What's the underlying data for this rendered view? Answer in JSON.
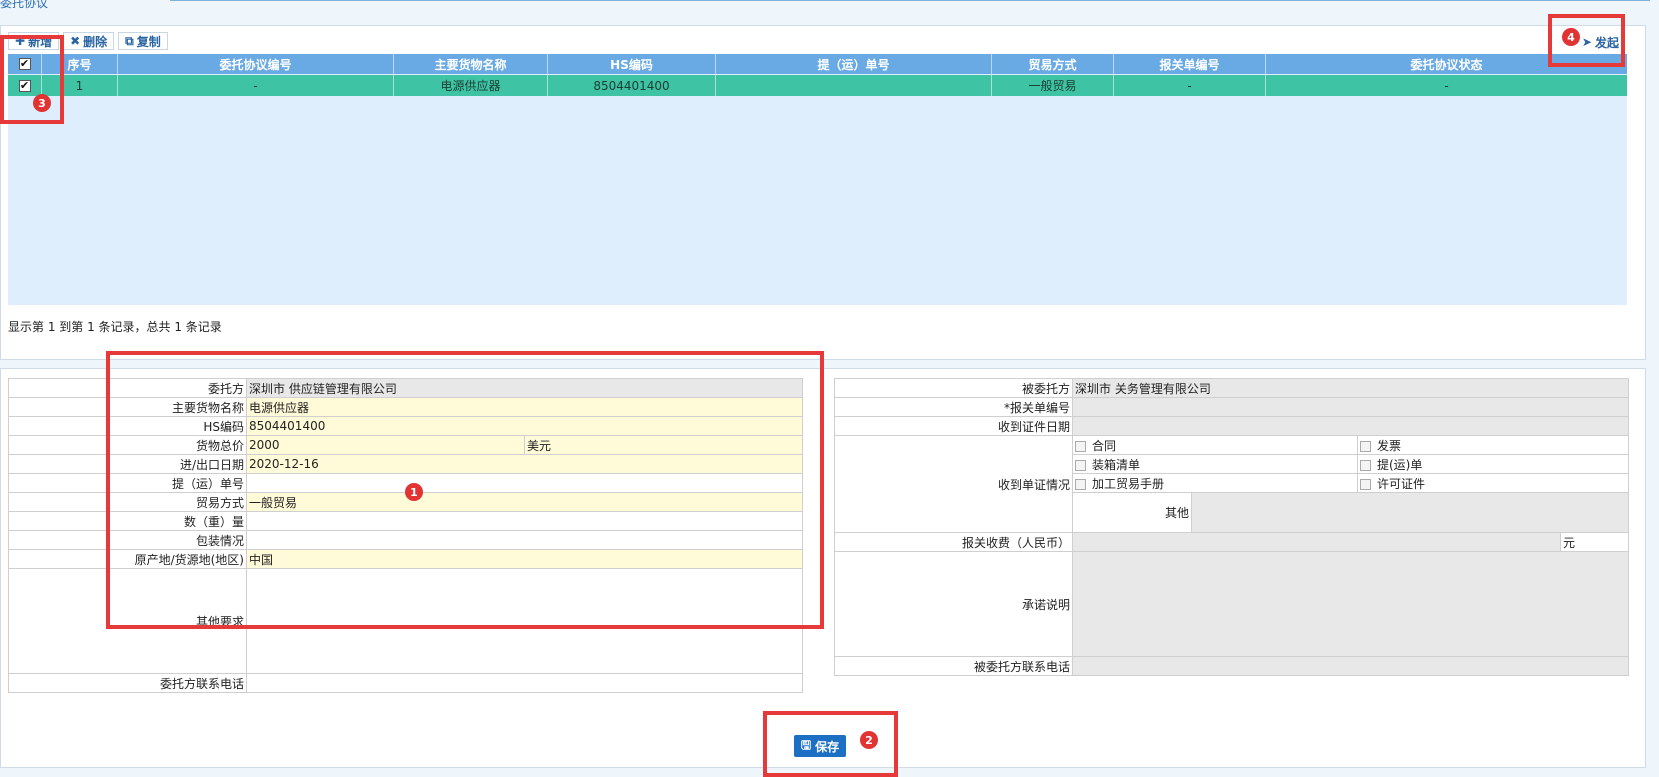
{
  "top_tab": "委托协议",
  "toolbar": {
    "add": "新增",
    "delete": "删除",
    "copy": "复制",
    "launch": "发起"
  },
  "grid": {
    "headers": [
      "序号",
      "委托协议编号",
      "主要货物名称",
      "HS编码",
      "提（运）单号",
      "贸易方式",
      "报关单编号",
      "委托协议状态"
    ],
    "row": [
      "1",
      "-",
      "电源供应器",
      "8504401400",
      "",
      "一般贸易",
      "-",
      "-"
    ]
  },
  "footer": "显示第 1 到第 1 条记录，总共 1 条记录",
  "left_form": {
    "labels": {
      "client": "委托方",
      "goods": "主要货物名称",
      "hs": "HS编码",
      "total": "货物总价",
      "date": "进/出口日期",
      "bill": "提（运）单号",
      "trade": "贸易方式",
      "qty": "数（重）量",
      "packing": "包装情况",
      "origin": "原产地/货源地(地区)",
      "other": "其他要求",
      "phone": "委托方联系电话"
    },
    "values": {
      "client": "深圳市    供应链管理有限公司",
      "goods": "电源供应器",
      "hs": "8504401400",
      "total": "2000",
      "currency": "美元",
      "date": "2020-12-16",
      "bill": "",
      "trade": "一般贸易",
      "qty": "",
      "packing": "",
      "origin": "中国"
    }
  },
  "right_form": {
    "labels": {
      "entrusted": "被委托方",
      "decl_no": "*报关单编号",
      "cert_date": "收到证件日期",
      "docs": "收到单证情况",
      "other": "其他",
      "fee": "报关收费（人民币）",
      "unit": "元",
      "promise": "承诺说明",
      "phone": "被委托方联系电话"
    },
    "values": {
      "entrusted": "深圳市    关务管理有限公司"
    },
    "checkboxes": [
      "合同",
      "发票",
      "装箱清单",
      "提(运)单",
      "加工贸易手册",
      "许可证件"
    ]
  },
  "save": "保存",
  "badges": [
    "1",
    "2",
    "3",
    "4"
  ],
  "colors": {
    "header": "#6aaae4",
    "selected_row": "#3ec4a4",
    "highlight": "#e63a3a",
    "yellow": "#fffbd8"
  }
}
